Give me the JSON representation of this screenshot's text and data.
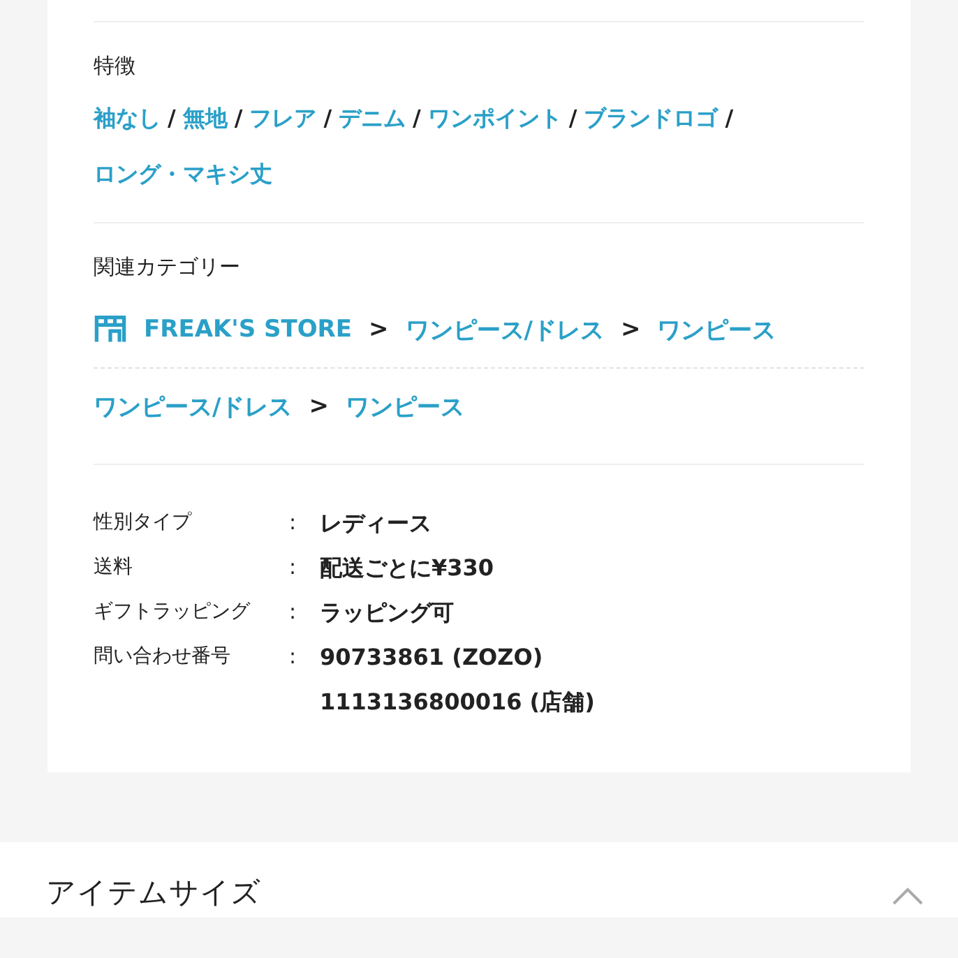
{
  "features": {
    "label": "特徴",
    "separator": "/",
    "tags": [
      "袖なし",
      "無地",
      "フレア",
      "デニム",
      "ワンポイント",
      "ブランドロゴ",
      "ロング・マキシ丈"
    ]
  },
  "related": {
    "label": "関連カテゴリー",
    "separator": ">",
    "paths": [
      {
        "kind": "store",
        "items": [
          "FREAK'S STORE",
          "ワンピース/ドレス",
          "ワンピース"
        ]
      },
      {
        "kind": "category",
        "items": [
          "ワンピース/ドレス",
          "ワンピース"
        ]
      }
    ]
  },
  "specs": {
    "delimiter": ":",
    "rows": [
      {
        "label": "性別タイプ",
        "values": [
          "レディース"
        ]
      },
      {
        "label": "送料",
        "values": [
          "配送ごとに¥330"
        ]
      },
      {
        "label": "ギフトラッピング",
        "values": [
          "ラッピング可"
        ]
      },
      {
        "label": "問い合わせ番号",
        "values": [
          "90733861 (ZOZO)",
          "1113136800016 (店舗)"
        ]
      }
    ]
  },
  "next_section": {
    "title": "アイテムサイズ",
    "expanded": true
  }
}
